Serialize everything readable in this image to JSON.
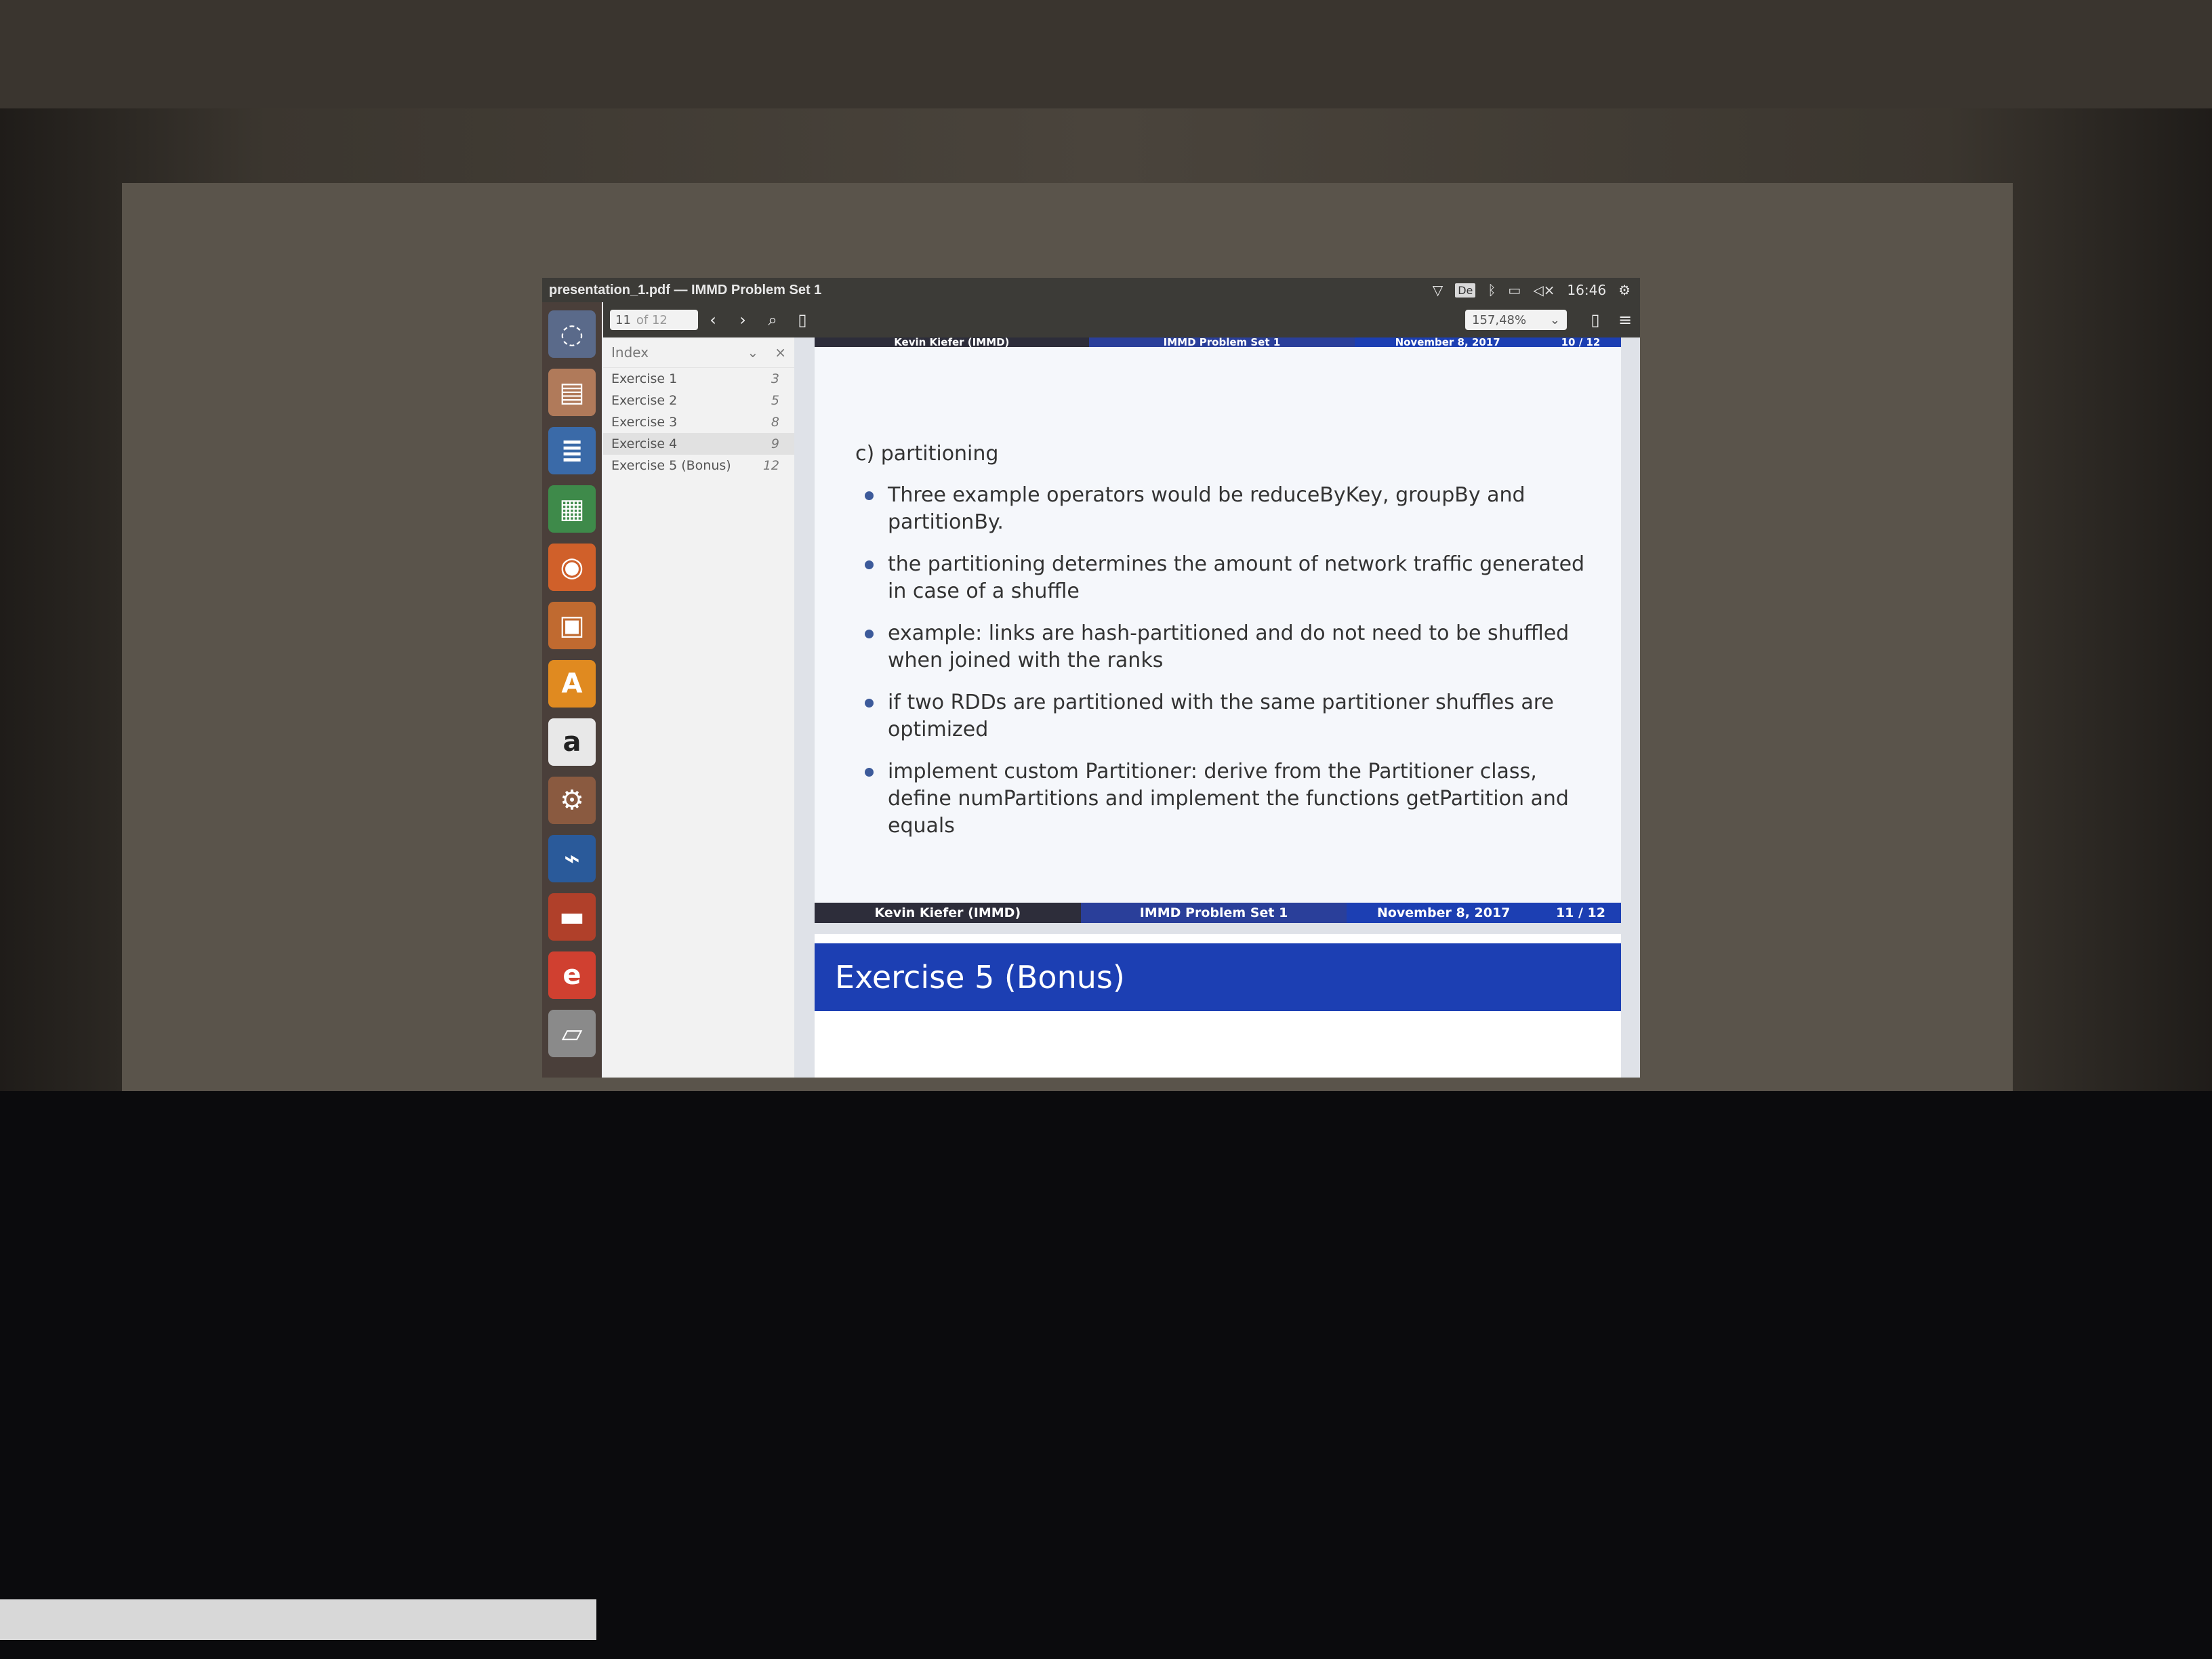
{
  "window": {
    "title": "presentation_1.pdf — IMMD Problem Set 1",
    "keyboard_layout": "De",
    "clock": "16:46"
  },
  "toolbar": {
    "page_current": "11",
    "page_total": "of 12",
    "zoom": "157,48%"
  },
  "sidebar": {
    "heading": "Index",
    "items": [
      {
        "label": "Exercise 1",
        "page": "3"
      },
      {
        "label": "Exercise 2",
        "page": "5"
      },
      {
        "label": "Exercise 3",
        "page": "8"
      },
      {
        "label": "Exercise 4",
        "page": "9"
      },
      {
        "label": "Exercise 5 (Bonus)",
        "page": "12"
      }
    ]
  },
  "prev_slide_footer": {
    "author": "Kevin Kiefer  (IMMD)",
    "title": "IMMD Problem Set 1",
    "date": "November 8, 2017",
    "page": "10 / 12"
  },
  "slide": {
    "heading": "c) partitioning",
    "bullets": [
      "Three example operators would be reduceByKey, groupBy and partitionBy.",
      "the partitioning determines the amount of network traffic generated in case of a shuffle",
      "example: links are hash-partitioned and do not need to be shuffled when joined with the ranks",
      "if two RDDs are partitioned with the same partitioner shuffles are optimized",
      "implement custom Partitioner: derive from the Partitioner class, define numPartitions and implement the functions getPartition and equals"
    ],
    "footer": {
      "author": "Kevin Kiefer  (IMMD)",
      "title": "IMMD Problem Set 1",
      "date": "November 8, 2017",
      "page": "11 / 12"
    }
  },
  "next_slide": {
    "frametitle": "Exercise 5 (Bonus)"
  },
  "launcher_icons": [
    "ubuntu-dash-icon",
    "files-icon",
    "writer-icon",
    "calc-icon",
    "firefox-icon",
    "impress-icon",
    "software-center-icon",
    "amazon-icon",
    "settings-icon",
    "system-monitor-icon",
    "image-viewer-icon",
    "document-viewer-icon",
    "trash-icon"
  ],
  "colors": {
    "beamer_blue": "#1c3fb3",
    "beamer_dark": "#2d2d3a",
    "topbar": "#3c3b37",
    "launcher": "#4a3f3a",
    "bullet": "#3c5a9a"
  }
}
